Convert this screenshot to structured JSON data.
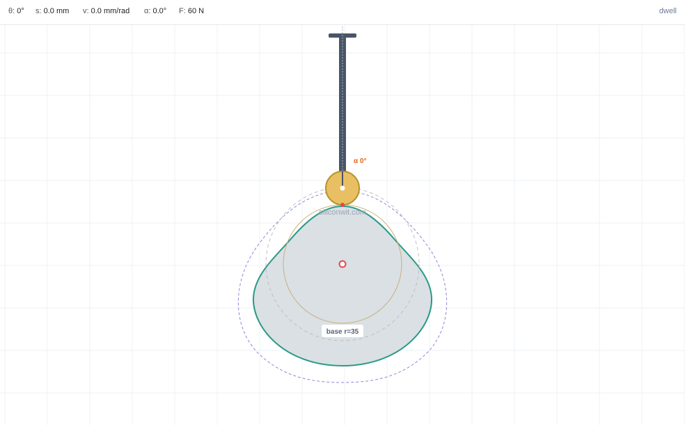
{
  "readouts": [
    {
      "key": "θ:",
      "value": "0°"
    },
    {
      "key": "s:",
      "value": "0.0 mm"
    },
    {
      "key": "v:",
      "value": "0.0 mm/rad"
    },
    {
      "key": "α:",
      "value": "0.0°"
    },
    {
      "key": "F:",
      "value": "60 N"
    }
  ],
  "mode": "dwell",
  "labels": {
    "pressure_angle": "α 0°",
    "base_circle": "base r=35",
    "watermark": "siliconwit.com"
  },
  "colors": {
    "cam_fill": "#d8dee3",
    "cam_stroke": "#2a9a88",
    "follower_rod": "#4a5568",
    "roller_fill": "#e8c063",
    "roller_stroke": "#b8902a",
    "pitch_curve": "#8f86d6",
    "base_circle": "#c9b07a",
    "pivot": "#e5484d",
    "contact": "#e5484d",
    "pressure_label": "#e06a1a"
  }
}
